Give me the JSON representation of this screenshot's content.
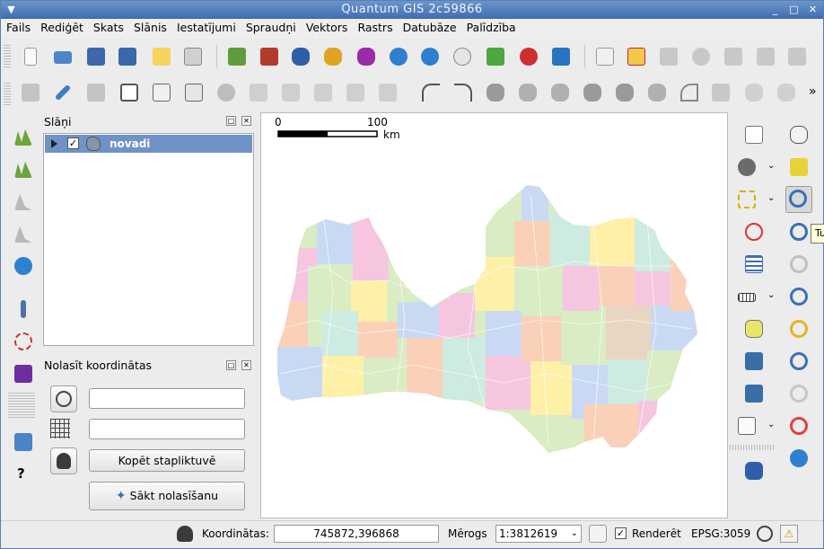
{
  "window": {
    "title": "Quantum GIS 2c59866"
  },
  "menu": [
    "Fails",
    "Rediģēt",
    "Skats",
    "Slānis",
    "Iestatījumi",
    "Spraudņi",
    "Vektors",
    "Rastrs",
    "Datubāze",
    "Palīdzība"
  ],
  "toolbar1_icons": [
    "new-project",
    "open-project",
    "save-project",
    "save-as-project",
    "new-print-composer",
    "print",
    "add-vector-layer",
    "add-raster-layer",
    "add-postgis-layer",
    "add-spatialite-layer",
    "add-mssql-layer",
    "add-wms-layer",
    "add-wcs-layer",
    "add-wfs-layer",
    "add-delimited-text-layer",
    "remove-layer",
    "new-shapefile-layer",
    "spell-check",
    "plugin-manager",
    "tag",
    "eye",
    "label",
    "move-label",
    "rotate-label"
  ],
  "toolbar2_icons": [
    "current-edits",
    "toggle-editing",
    "save-layer-edits",
    "add-feature",
    "move-feature",
    "node-tool",
    "delete-selected",
    "cut-features",
    "copy-features",
    "paste-features",
    "split-features",
    "merge-features",
    "undo",
    "redo",
    "simplify-feature",
    "add-ring",
    "add-part",
    "fill-ring",
    "delete-ring",
    "delete-part",
    "reshape-features",
    "offset-curve",
    "split-parts",
    "rotate-point-symbols",
    "more"
  ],
  "toolbar2_overflow": "»",
  "layers_panel": {
    "title": "Slāņi",
    "layers": [
      {
        "name": "novadi",
        "checked": true
      }
    ]
  },
  "coord_panel": {
    "title": "Nolasīt koordinātas",
    "copy_button": "Kopēt stapliktuvē",
    "start_button": "Sākt nolasīšanu",
    "field1_value": "",
    "field2_value": ""
  },
  "scalebar": {
    "start": "0",
    "end": "100",
    "unit": "km"
  },
  "tooltip": "Tu",
  "status": {
    "coords_label": "Koordinātas:",
    "coords_value": "745872,396868",
    "scale_label": "Mērogs",
    "scale_value": "1:3812619",
    "render_label": "Renderēt",
    "render_checked": true,
    "crs": "EPSG:3059"
  },
  "colors": {
    "title_bar": "#4a78b8",
    "selection": "#6f93c7"
  }
}
